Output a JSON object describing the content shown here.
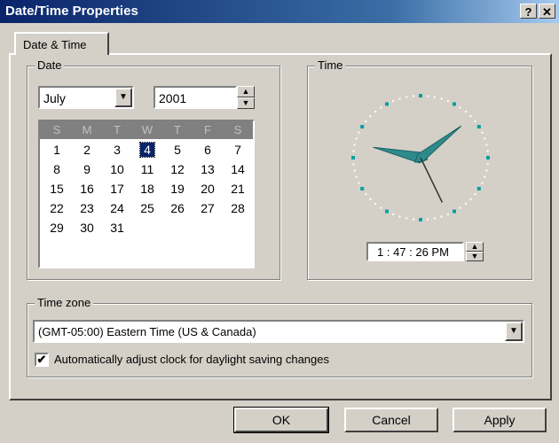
{
  "window": {
    "title": "Date/Time Properties",
    "help_glyph": "?",
    "close_glyph": "✕"
  },
  "tabs": [
    {
      "label": "Date & Time"
    }
  ],
  "date_group": {
    "label": "Date",
    "month": "July",
    "year": "2001",
    "weekdays": [
      "S",
      "M",
      "T",
      "W",
      "T",
      "F",
      "S"
    ],
    "weeks": [
      [
        "1",
        "2",
        "3",
        "4",
        "5",
        "6",
        "7"
      ],
      [
        "8",
        "9",
        "10",
        "11",
        "12",
        "13",
        "14"
      ],
      [
        "15",
        "16",
        "17",
        "18",
        "19",
        "20",
        "21"
      ],
      [
        "22",
        "23",
        "24",
        "25",
        "26",
        "27",
        "28"
      ],
      [
        "29",
        "30",
        "31",
        "",
        "",
        "",
        ""
      ]
    ],
    "selected_day": "4"
  },
  "time_group": {
    "label": "Time",
    "time_value": "1 : 47 : 26 PM",
    "clock": {
      "hour": 1,
      "minute": 47,
      "second": 26,
      "hand_color": "#2e8b8b"
    }
  },
  "timezone_group": {
    "label": "Time zone",
    "selected": "(GMT-05:00) Eastern Time (US & Canada)",
    "dst_checkbox_label": "Automatically adjust clock for daylight saving changes",
    "dst_checked": true
  },
  "buttons": {
    "ok": "OK",
    "cancel": "Cancel",
    "apply": "Apply"
  }
}
